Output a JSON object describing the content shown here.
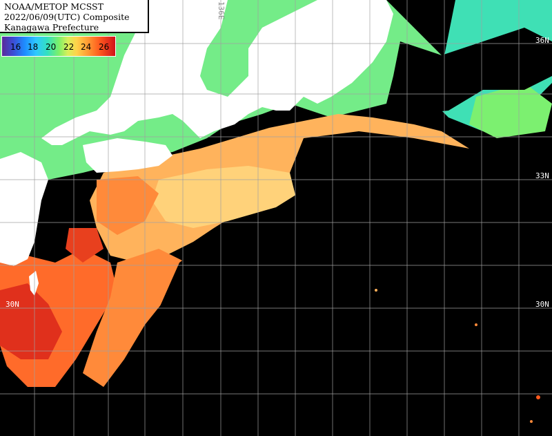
{
  "header": {
    "line1": "NOAA/METOP MCSST",
    "line2": "2022/06/09(UTC) Composite",
    "line3": "Kanagawa Prefecture"
  },
  "legend": {
    "ticks": [
      "16",
      "18",
      "20",
      "22",
      "24",
      "26"
    ],
    "colors": [
      "#5a2a9a",
      "#3b4fd6",
      "#1e8cff",
      "#2ec8ff",
      "#33e0c0",
      "#7bf06a",
      "#d8ef5a",
      "#ffd24a",
      "#ff9a33",
      "#ff5a1e",
      "#d1121a"
    ]
  },
  "grid": {
    "lon_label_top": "136E",
    "lat_33_right": "33N",
    "lat_36_right": "36N",
    "lat_30_left": "30N",
    "lat_30_right": "30N"
  },
  "colors": {
    "land": "#ffffff",
    "no_data": "#000000",
    "cool": "#6ee88a",
    "warm": "#ffb05a",
    "hot": "#e8301e",
    "grid": "#9a9a9a"
  }
}
